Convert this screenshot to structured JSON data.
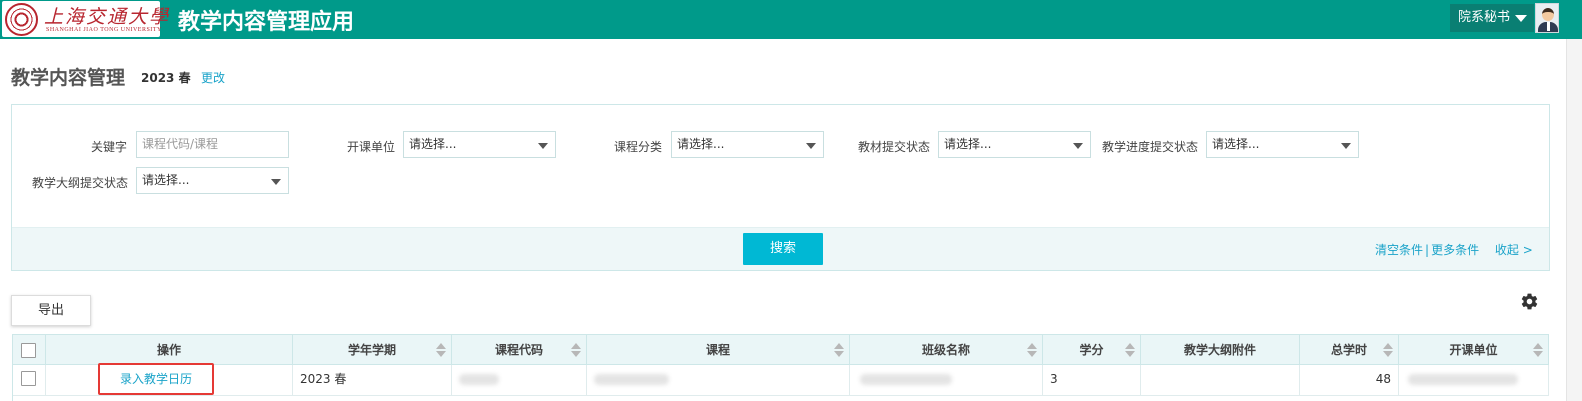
{
  "header": {
    "logo_cn": "上海交通大學",
    "logo_en": "SHANGHAI JIAO TONG UNIVERSITY",
    "app_title": "教学内容管理应用",
    "user_role": "院系秘书",
    "brand_color": "#009a8a"
  },
  "page": {
    "title": "教学内容管理",
    "term": "2023 春",
    "change_label": "更改"
  },
  "filters": {
    "keyword_label": "关键字",
    "keyword_placeholder": "课程代码/课程",
    "department_label": "开课单位",
    "category_label": "课程分类",
    "textbook_label": "教材提交状态",
    "progress_label": "教学进度提交状态",
    "syllabus_label": "教学大纲提交状态",
    "select_placeholder": "请选择...",
    "search_label": "搜索",
    "clear_label": "清空条件",
    "more_label": "更多条件",
    "collapse_label": "收起 >"
  },
  "toolbar": {
    "export_label": "导出",
    "settings_icon": "gear-icon"
  },
  "table": {
    "columns": [
      "操作",
      "学年学期",
      "课程代码",
      "课程",
      "班级名称",
      "学分",
      "教学大纲附件",
      "总学时",
      "开课单位"
    ],
    "rows": [
      {
        "action": "录入教学日历",
        "term": "2023 春",
        "course_code": "",
        "course": "",
        "class_name": "",
        "credits": "3",
        "syllabus_attachment": "",
        "total_hours": "48",
        "department": ""
      }
    ]
  },
  "colors": {
    "accent": "#00b8d4",
    "link": "#1aa3c9",
    "highlight_border": "#e53935"
  }
}
